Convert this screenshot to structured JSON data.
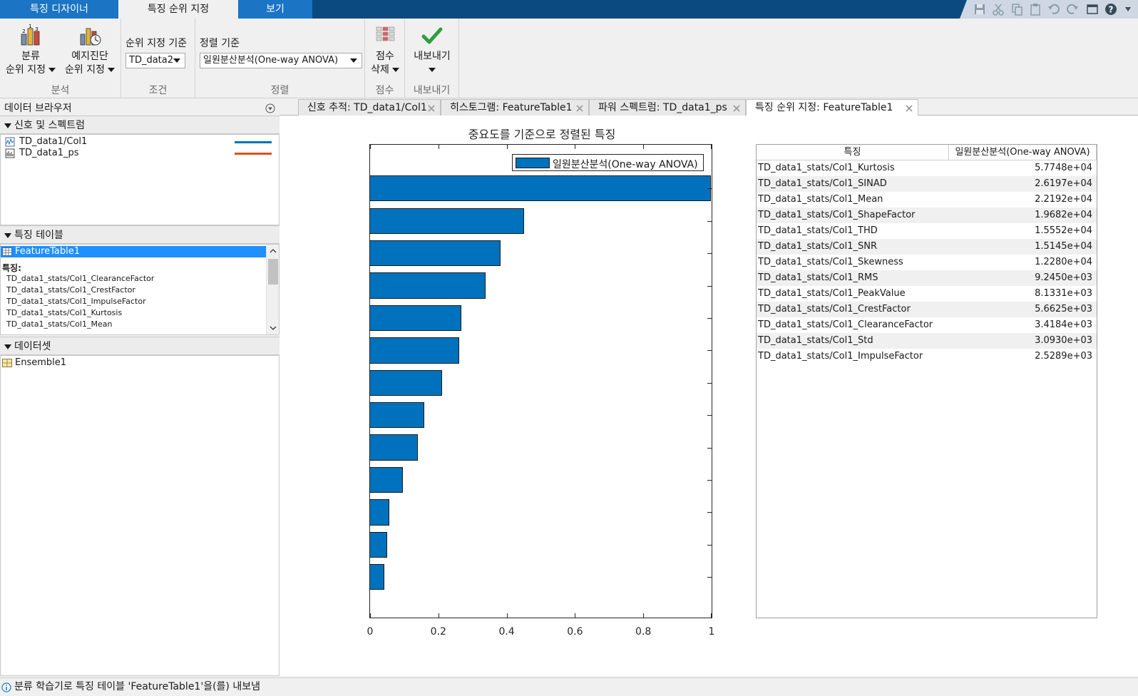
{
  "main_tabs": [
    {
      "label": "특징 디자이너"
    },
    {
      "label": "특징 순위 지정"
    },
    {
      "label": "보기"
    }
  ],
  "toolstrip": {
    "analysis": {
      "group_label": "분석",
      "classify_line1": "분류",
      "classify_line2": "순위 지정",
      "prognostic_line1": "예지진단",
      "prognostic_line2": "순위 지정"
    },
    "condition": {
      "group_label": "조건",
      "rank_by_label": "순위 지정 기준",
      "rank_by_value": "TD_data2"
    },
    "sort": {
      "group_label": "정렬",
      "sort_by_label": "정렬 기준",
      "sort_by_value": "일원분산분석(One-way ANOVA)"
    },
    "score": {
      "group_label": "점수",
      "delete_line1": "점수",
      "delete_line2": "삭제"
    },
    "export": {
      "group_label": "내보내기",
      "export_label": "내보내기"
    }
  },
  "left_panel": {
    "title": "데이터 브라우저",
    "signals_header": "신호 및 스펙트럼",
    "signals": [
      {
        "label": "TD_data1/Col1",
        "color": "#0072bd"
      },
      {
        "label": "TD_data1_ps",
        "color": "#d95319"
      }
    ],
    "feature_tables_header": "특징 테이블",
    "feature_table_name": "FeatureTable1",
    "features_label": "특징:",
    "features": [
      "TD_data1_stats/Col1_ClearanceFactor",
      "TD_data1_stats/Col1_CrestFactor",
      "TD_data1_stats/Col1_ImpulseFactor",
      "TD_data1_stats/Col1_Kurtosis",
      "TD_data1_stats/Col1_Mean"
    ],
    "datasets_header": "데이터셋",
    "dataset_name": "Ensemble1"
  },
  "doc_tabs": [
    {
      "label": "신호 추적: TD_data1/Col1"
    },
    {
      "label": "히스토그램: FeatureTable1"
    },
    {
      "label": "파워 스펙트럼: TD_data1_ps"
    },
    {
      "label": "특징 순위 지정: FeatureTable1"
    }
  ],
  "chart_data": {
    "type": "bar",
    "orientation": "horizontal",
    "title": "중요도를 기준으로 정렬된 특징",
    "legend": [
      "일원분산분석(One-way ANOVA)"
    ],
    "legend_position": "top-right",
    "series": [
      {
        "name": "일원분산분석(One-way ANOVA)",
        "values": [
          1.0,
          0.454,
          0.384,
          0.341,
          0.27,
          0.263,
          0.213,
          0.16,
          0.141,
          0.098,
          0.058,
          0.052,
          0.044
        ]
      }
    ],
    "xlim": [
      0,
      1
    ],
    "xticks": [
      "0",
      "0.2",
      "0.4",
      "0.6",
      "0.8",
      "1"
    ],
    "xtick_values": [
      0,
      0.2,
      0.4,
      0.6,
      0.8,
      1
    ],
    "color": "#0072bd"
  },
  "table": {
    "headers": [
      "특징",
      "일원분산분석(One-way ANOVA)"
    ],
    "rows": [
      {
        "name": "TD_data1_stats/Col1_Kurtosis",
        "value": "5.7748e+04"
      },
      {
        "name": "TD_data1_stats/Col1_SINAD",
        "value": "2.6197e+04"
      },
      {
        "name": "TD_data1_stats/Col1_Mean",
        "value": "2.2192e+04"
      },
      {
        "name": "TD_data1_stats/Col1_ShapeFactor",
        "value": "1.9682e+04"
      },
      {
        "name": "TD_data1_stats/Col1_THD",
        "value": "1.5552e+04"
      },
      {
        "name": "TD_data1_stats/Col1_SNR",
        "value": "1.5145e+04"
      },
      {
        "name": "TD_data1_stats/Col1_Skewness",
        "value": "1.2280e+04"
      },
      {
        "name": "TD_data1_stats/Col1_RMS",
        "value": "9.2450e+03"
      },
      {
        "name": "TD_data1_stats/Col1_PeakValue",
        "value": "8.1331e+03"
      },
      {
        "name": "TD_data1_stats/Col1_CrestFactor",
        "value": "5.6625e+03"
      },
      {
        "name": "TD_data1_stats/Col1_ClearanceFactor",
        "value": "3.4184e+03"
      },
      {
        "name": "TD_data1_stats/Col1_Std",
        "value": "3.0930e+03"
      },
      {
        "name": "TD_data1_stats/Col1_ImpulseFactor",
        "value": "2.5289e+03"
      }
    ]
  },
  "status_text": "분류 학습기로 특징 테이블 'FeatureTable1'을(를) 내보냄",
  "colors": {
    "accent": "#1b74c4",
    "title_bar": "#0b4a80",
    "selection": "#1e90ff",
    "bar": "#0072bd",
    "export_check": "#2e9e3e"
  }
}
